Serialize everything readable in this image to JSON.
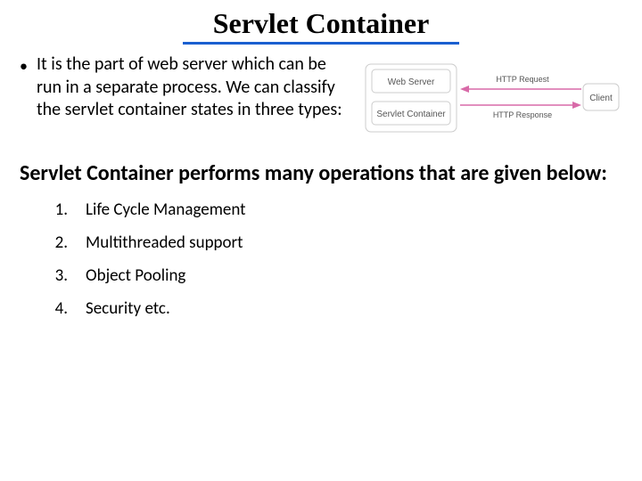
{
  "title": "Servlet Container",
  "intro": {
    "bullet_char": "•",
    "text": "It is the part of web server which can be run in a separate process. We can classify the servlet container states in three types:"
  },
  "diagram": {
    "web_server": "Web Server",
    "servlet_container": "Servlet Container",
    "client": "Client",
    "http_request": "HTTP Request",
    "http_response": "HTTP Response"
  },
  "subheading": "Servlet Container performs many operations that are given below:",
  "operations": [
    {
      "num": "1.",
      "text": "Life Cycle Management"
    },
    {
      "num": "2.",
      "text": "Multithreaded support"
    },
    {
      "num": "3.",
      "text": "Object Pooling"
    },
    {
      "num": "4.",
      "text": "Security etc."
    }
  ]
}
